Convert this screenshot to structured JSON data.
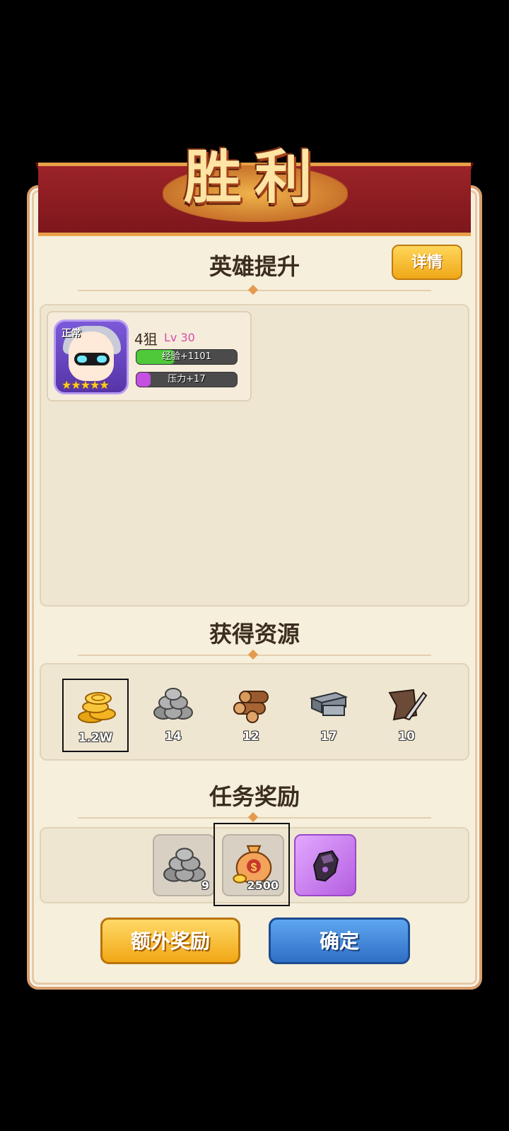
{
  "banner": {
    "title": "胜利"
  },
  "hero_section": {
    "title": "英雄提升",
    "details_label": "详情",
    "heroes": [
      {
        "status": "正常",
        "stars": "★★★★★",
        "star_count": 5,
        "name": "4狙",
        "level": "Lv 30",
        "exp_label": "经验+1101",
        "exp_fraction": 0.38,
        "exp_color": "#4fc83a",
        "pressure_label": "压力+17",
        "pressure_fraction": 0.14,
        "pressure_color": "#c44fe0"
      }
    ]
  },
  "resources_section": {
    "title": "获得资源",
    "items": [
      {
        "icon": "gold-coins-icon",
        "count": "1.2W",
        "selected": true
      },
      {
        "icon": "stone-pile-icon",
        "count": "14",
        "selected": false
      },
      {
        "icon": "wood-logs-icon",
        "count": "12",
        "selected": false
      },
      {
        "icon": "steel-beams-icon",
        "count": "17",
        "selected": false
      },
      {
        "icon": "leather-hide-icon",
        "count": "10",
        "selected": false
      }
    ]
  },
  "task_section": {
    "title": "任务奖励",
    "items": [
      {
        "icon": "stone-pile-icon",
        "count": "9",
        "selected": false
      },
      {
        "icon": "money-bag-icon",
        "count": "2500",
        "selected": true
      },
      {
        "icon": "purple-gauntlet-icon",
        "count": "",
        "selected": false
      }
    ]
  },
  "buttons": {
    "extra_reward": "额外奖励",
    "confirm": "确定"
  },
  "colors": {
    "ribbon": "#8f1e23",
    "panel": "#f6efdc",
    "gold_button": "#f1a715",
    "blue_button": "#2f6fc6",
    "purple_item": "#c07ae6"
  }
}
